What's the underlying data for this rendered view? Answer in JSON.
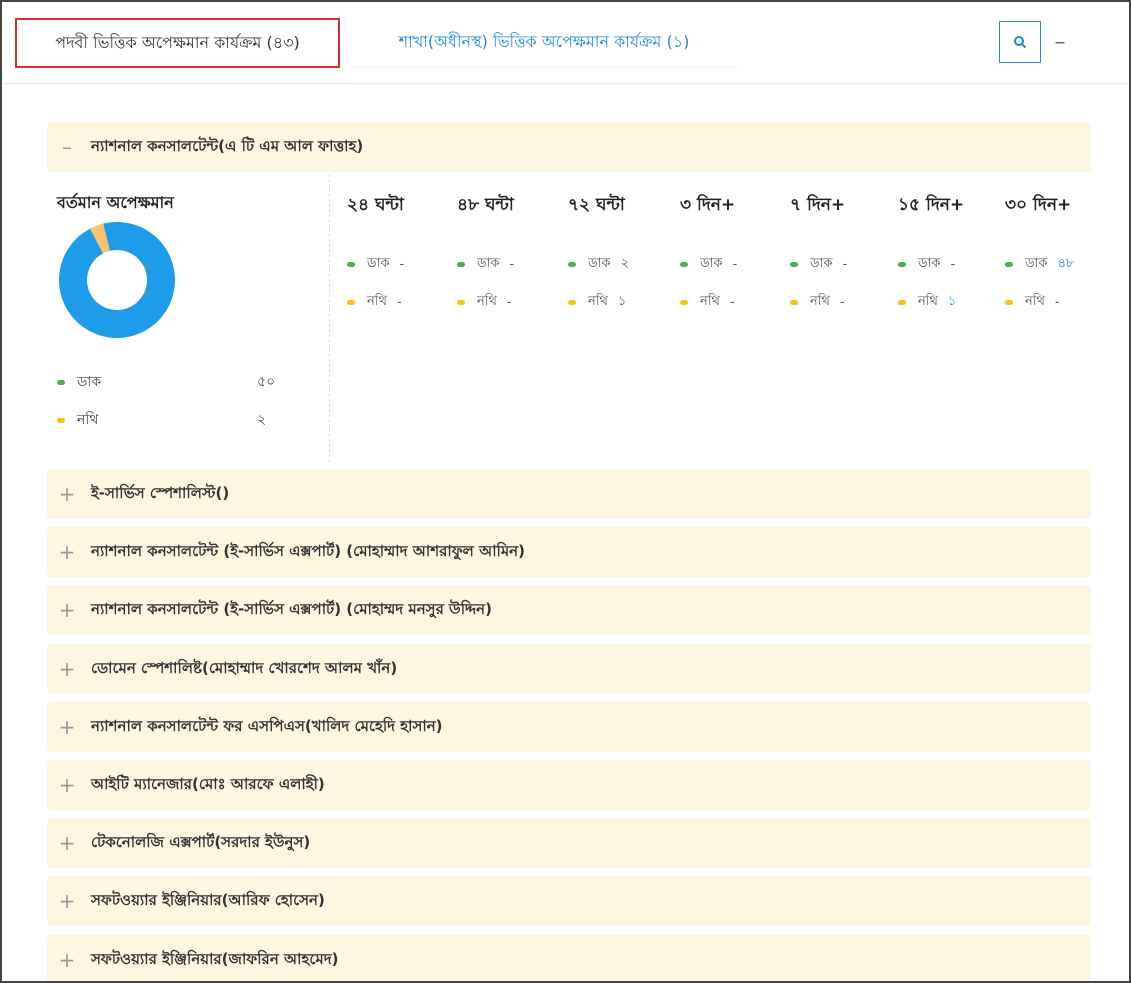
{
  "tabs": {
    "active_label": "পদবী ভিত্তিক অপেক্ষমান কার্যক্রম (৪৩)",
    "inactive_label": "শাখা(অধীনস্থ) ভিত্তিক অপেক্ষমান কার্যক্রম (১)",
    "dash": "–"
  },
  "expanded": {
    "sign": "–",
    "title": "ন্যাশনাল কনসালটেন্ট(এ টি এম আল ফাত্তাহ)",
    "summary_title": "বর্তমান অপেক্ষমান",
    "legend": [
      {
        "label": "ডাক",
        "value": "৫০",
        "color": "#4caf50"
      },
      {
        "label": "নথি",
        "value": "২",
        "color": "#ffc107"
      }
    ],
    "donut": {
      "slices": [
        {
          "label": "ডাক",
          "value": 50,
          "color": "#1e9be9"
        },
        {
          "label": "নথি",
          "value": 2,
          "color": "#f7c46c"
        }
      ]
    },
    "columns": [
      {
        "head": "২৪ ঘন্টা",
        "dak": "-",
        "nothi": "-"
      },
      {
        "head": "৪৮ ঘন্টা",
        "dak": "-",
        "nothi": "-"
      },
      {
        "head": "৭২ ঘন্টা",
        "dak": "২",
        "nothi": "১"
      },
      {
        "head": "৩ দিন+",
        "dak": "-",
        "nothi": "-"
      },
      {
        "head": "৭ দিন+",
        "dak": "-",
        "nothi": "-"
      },
      {
        "head": "১৫ দিন+",
        "dak": "-",
        "nothi": "১"
      },
      {
        "head": "৩০ দিন+",
        "dak": "৪৮",
        "nothi": "-"
      }
    ],
    "row_labels": {
      "dak": "ডাক",
      "nothi": "নথি"
    }
  },
  "collapsed": {
    "sign": "+",
    "items": [
      "ই-সার্ভিস স্পেশালিস্ট()",
      "ন্যাশনাল কনসালটেন্ট (ই-সার্ভিস এক্সপার্ট) (মোহাম্মাদ আশরাফুল আমিন)",
      "ন্যাশনাল কনসালটেন্ট (ই-সার্ভিস এক্সপার্ট) (মোহাম্মদ মনসুর উদ্দিন)",
      "ডোমেন স্পেশালিষ্ট(মোহাম্মাদ খোরশেদ আলম খাঁন)",
      "ন্যাশনাল কনসালটেন্ট ফর এসপিএস(খালিদ মেহেদি হাসান)",
      "আইটি ম্যানেজার(মোঃ আরফে এলাহী)",
      "টেকনোলজি এক্সপার্ট(সরদার ইউনুস)",
      "সফটওয়্যার ইঞ্জিনিয়ার(আরিফ হোসেন)",
      "সফটওয়্যার ইঞ্জিনিয়ার(জাফরিন আহমেদ)"
    ]
  },
  "colors": {
    "accent": "#1e88e5",
    "active_border": "#d32f2f",
    "row_bg": "#fdf6e1",
    "dak_dot": "#4caf50",
    "nothi_dot": "#ffc107"
  }
}
